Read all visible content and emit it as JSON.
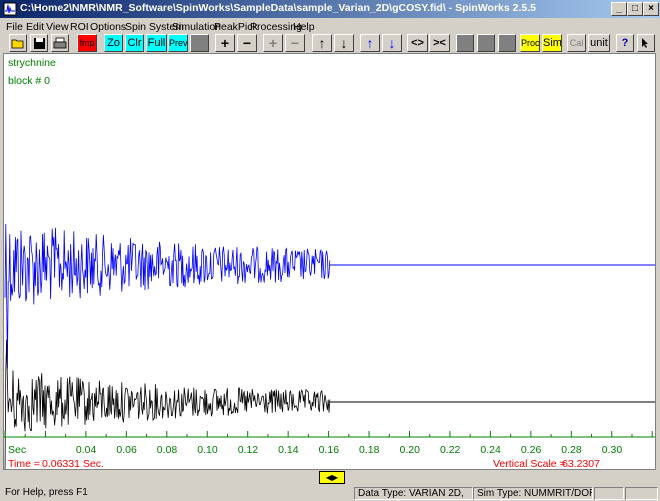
{
  "window": {
    "title": "C:\\Home2\\NMR\\NMR_Software\\SpinWorks\\SampleData\\sample_Varian_2D\\gCOSY.fid\\ - SpinWorks 2.5.5",
    "controls": {
      "minimize": "_",
      "maximize": "□",
      "close": "×"
    }
  },
  "menu": [
    "File",
    "Edit",
    "View",
    "ROI",
    "Options",
    "Spin System",
    "Simulation",
    "PeakPick",
    "Processing",
    "Help"
  ],
  "toolbar": {
    "fmp": "fmp",
    "zo": "Zo",
    "clr": "Clr",
    "full": "Full",
    "prev": "Prev",
    "plus": "+",
    "minus": "−",
    "plus2": "+",
    "minus2": "−",
    "up": "↑",
    "down": "↓",
    "up2": "↑",
    "down2": "↓",
    "expand": "<>",
    "contract": "><",
    "proc": "Proc",
    "sim": "Sim",
    "cal": "Cal",
    "unit": "unit",
    "help": "?"
  },
  "plot": {
    "sample_name": "strychnine",
    "block": "block # 0",
    "axis_unit": "Sec",
    "ticks": [
      "0.04",
      "0.06",
      "0.08",
      "0.10",
      "0.12",
      "0.14",
      "0.16",
      "0.18",
      "0.20",
      "0.22",
      "0.24",
      "0.26",
      "0.28",
      "0.30"
    ],
    "time_label": "Time =",
    "time_value": "0.06331 Sec.",
    "vscale_label": "Vertical Scale =",
    "vscale_value": "63.2307",
    "colors": {
      "real": "#0000ff",
      "imag": "#000000",
      "axis": "#008000",
      "readout": "#ff0000"
    }
  },
  "scrollbar": {
    "thumb": "◀▶"
  },
  "status": {
    "help": "For Help, press F1",
    "data_type": "Data Type: VARIAN 2D,",
    "sim_type": "Sim Type: NUMMRIT/DOR"
  }
}
